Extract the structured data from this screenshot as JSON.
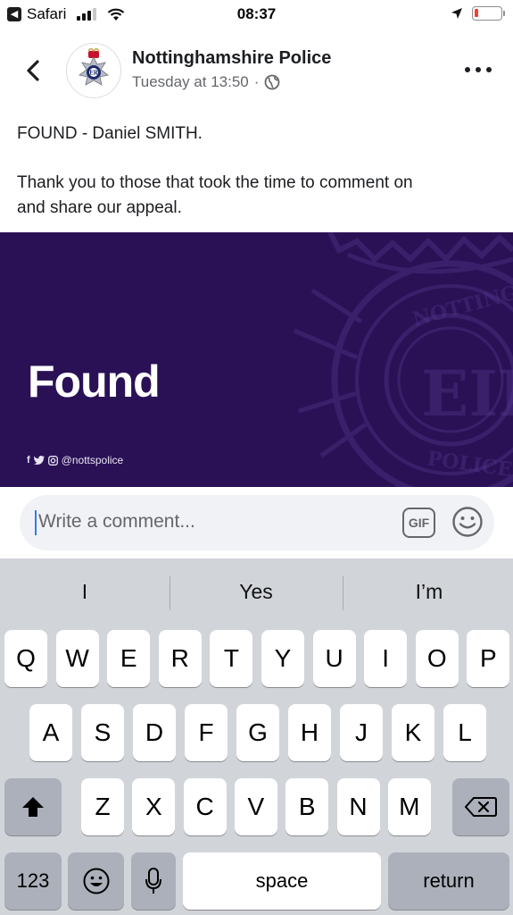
{
  "status_bar": {
    "carrier": "Safari",
    "time": "08:37",
    "battery_level": 0.15,
    "battery_color": "#ff3b30"
  },
  "post": {
    "page_name": "Nottinghamshire Police",
    "timestamp": "Tuesday at 13:50",
    "separator": "·",
    "text_lines": [
      "FOUND - Daniel SMITH.",
      "Thank you to those that took the time to comment on",
      "and share our appeal."
    ],
    "image": {
      "headline": "Found",
      "handle": "@nottspolice",
      "background": "#2a1156",
      "badge_text_top": "NOTTINGHAMSHIRE",
      "badge_text_bottom": "POLICE",
      "badge_monogram": "EIIR"
    }
  },
  "comment": {
    "placeholder": "Write a comment...",
    "gif_label": "GIF"
  },
  "keyboard": {
    "suggestions": [
      "I",
      "Yes",
      "I’m"
    ],
    "row1": [
      "Q",
      "W",
      "E",
      "R",
      "T",
      "Y",
      "U",
      "I",
      "O",
      "P"
    ],
    "row2": [
      "A",
      "S",
      "D",
      "F",
      "G",
      "H",
      "J",
      "K",
      "L"
    ],
    "row3": [
      "Z",
      "X",
      "C",
      "V",
      "B",
      "N",
      "M"
    ],
    "numbers_label": "123",
    "space_label": "space",
    "return_label": "return"
  },
  "colors": {
    "accent": "#3478f6",
    "text_secondary": "#65676b",
    "keyboard_bg": "#d1d4d9"
  }
}
